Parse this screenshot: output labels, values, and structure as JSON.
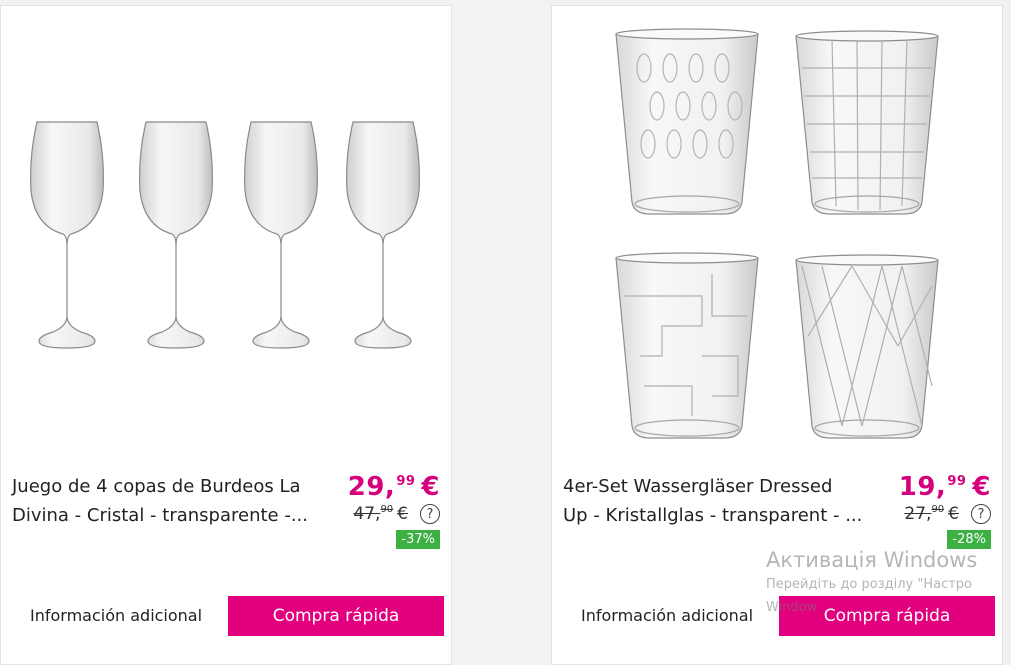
{
  "products": [
    {
      "title_line1": "Juego de 4 copas de Burdeos La",
      "title_line2": "Divina - Cristal - transparente -...",
      "price_main": "29,",
      "price_cents": "99",
      "currency": "€",
      "old_price_main": "47,",
      "old_price_cents": "90",
      "discount": "-37%",
      "info_label": "Información adicional",
      "button_label": "Compra rápida"
    },
    {
      "title_line1": "4er-Set Wassergläser Dressed",
      "title_line2": "Up - Kristallglas - transparent - ...",
      "price_main": "19,",
      "price_cents": "99",
      "currency": "€",
      "old_price_main": "27,",
      "old_price_cents": "90",
      "discount": "-28%",
      "info_label": "Información adicional",
      "button_label": "Compra rápida"
    }
  ],
  "help_glyph": "?",
  "watermark": {
    "title": "Активація Windows",
    "subtitle_line1": "Перейдіть до розділу \"Настро",
    "subtitle_line2": "Window"
  },
  "colors": {
    "accent": "#e3007e",
    "price": "#d6007e",
    "discount": "#3cb043"
  }
}
